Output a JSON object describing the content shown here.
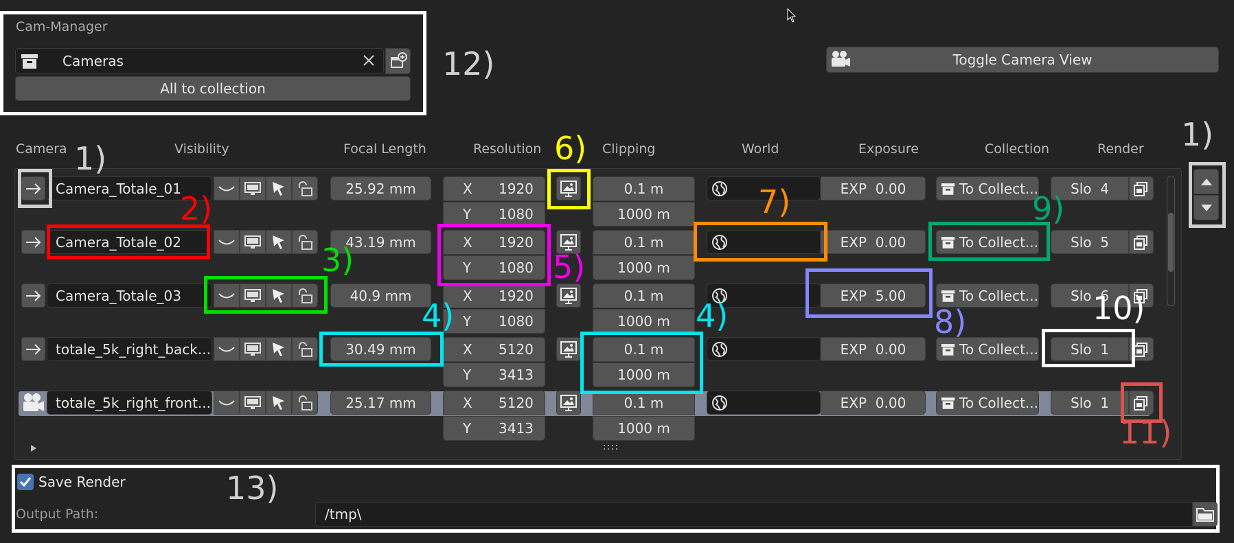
{
  "panel": {
    "title": "Cam-Manager",
    "collection_field": "Cameras",
    "all_to_collection": "All to collection"
  },
  "toggle_camera_view": "Toggle Camera View",
  "headers": {
    "camera": "Camera",
    "visibility": "Visibility",
    "focal_length": "Focal Length",
    "resolution": "Resolution",
    "clipping": "Clipping",
    "world": "World",
    "exposure": "Exposure",
    "collection": "Collection",
    "render": "Render"
  },
  "rows": [
    {
      "name": "Camera_Totale_01",
      "focal": "25.92 mm",
      "x_label": "X",
      "x": "1920",
      "y_label": "Y",
      "y": "1080",
      "clip_start": "0.1 m",
      "clip_end": "1000 m",
      "exposure": "EXP  0.00",
      "collection": "To Collect...",
      "slot": "Slo  4"
    },
    {
      "name": "Camera_Totale_02",
      "focal": "43.19 mm",
      "x_label": "X",
      "x": "1920",
      "y_label": "Y",
      "y": "1080",
      "clip_start": "0.1 m",
      "clip_end": "1000 m",
      "exposure": "EXP  0.00",
      "collection": "To Collect...",
      "slot": "Slo  5"
    },
    {
      "name": "Camera_Totale_03",
      "focal": "40.9 mm",
      "x_label": "X",
      "x": "1920",
      "y_label": "Y",
      "y": "1080",
      "clip_start": "0.1 m",
      "clip_end": "1000 m",
      "exposure": "EXP  5.00",
      "collection": "To Collect...",
      "slot": "Slo  6"
    },
    {
      "name": "totale_5k_right_back...",
      "focal": "30.49 mm",
      "x_label": "X",
      "x": "5120",
      "y_label": "Y",
      "y": "3413",
      "clip_start": "0.1 m",
      "clip_end": "1000 m",
      "exposure": "EXP  0.00",
      "collection": "To Collect...",
      "slot": "Slo  1"
    },
    {
      "name": "totale_5k_right_front...",
      "focal": "25.17 mm",
      "x_label": "X",
      "x": "5120",
      "y_label": "Y",
      "y": "3413",
      "clip_start": "0.1 m",
      "clip_end": "1000 m",
      "exposure": "EXP  0.00",
      "collection": "To Collect...",
      "slot": "Slo  1"
    }
  ],
  "footer": {
    "save_render": "Save Render",
    "save_render_checked": true,
    "output_path_label": "Output Path:",
    "output_path": "/tmp\\"
  },
  "annotations": {
    "a1": "1)",
    "a1b": "1)",
    "a2": "2)",
    "a3": "3)",
    "a4": "4)",
    "a4b": "4)",
    "a5": "5)",
    "a6": "6)",
    "a7": "7)",
    "a8": "8)",
    "a9": "9)",
    "a10": "10)",
    "a11": "11)",
    "a12": "12)",
    "a13": "13)"
  },
  "colors": {
    "background": "#232323",
    "field": "#545454",
    "active_row": "#7f8799",
    "red": "#ff0000",
    "green": "#00e000",
    "cyan": "#00e5ee",
    "yellow": "#ffff00",
    "magenta": "#ee00ee",
    "orange": "#ff8c00",
    "periwinkle": "#8585ff",
    "teal": "#00a870",
    "white": "#ffffff",
    "salmon": "#d9534f"
  },
  "icons": [
    "arrow-right-icon",
    "camera-icon",
    "visibility-curve-icon",
    "monitor-icon",
    "cursor-icon",
    "unlock-icon",
    "image-frame-icon",
    "world-icon",
    "collection-box-icon",
    "render-slot-icon",
    "folder-icon",
    "chevron-up-icon",
    "chevron-down-icon",
    "close-icon",
    "new-collection-icon",
    "checkbox-icon",
    "expand-triangle-icon",
    "mouse-cursor-icon"
  ]
}
